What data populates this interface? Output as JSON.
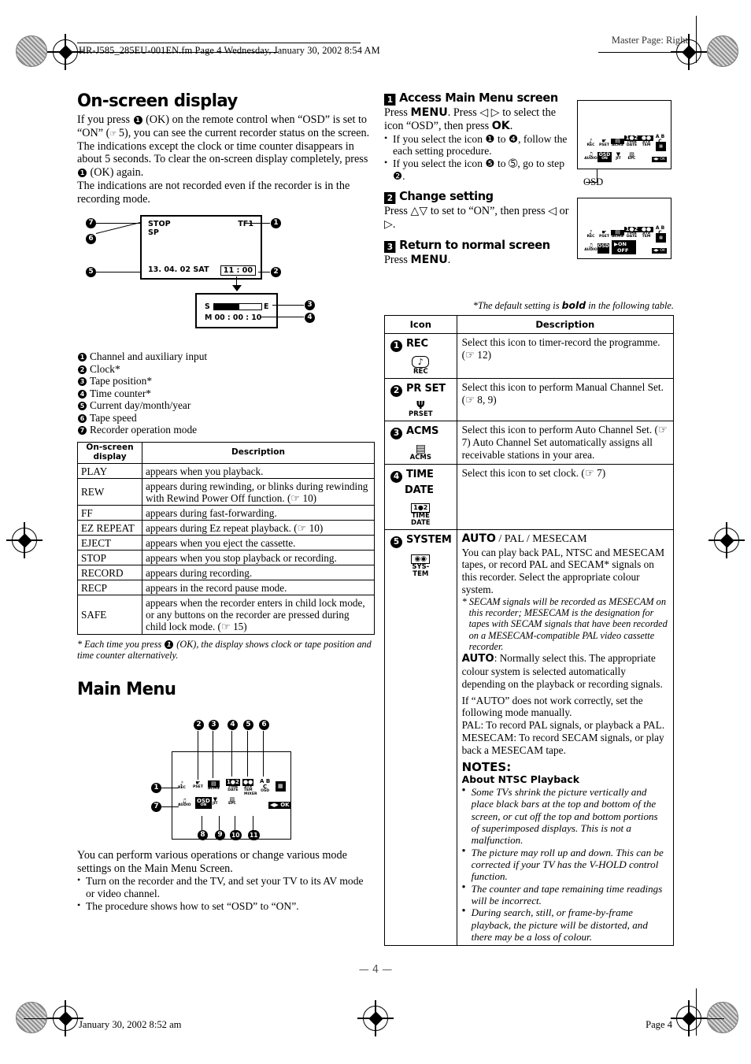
{
  "page": {
    "fm_header": "HR-J585_285EU-001EN.fm  Page 4  Wednesday, January 30, 2002  8:54 AM",
    "master_page": "Master Page: Right",
    "page_number": "— 4 —",
    "footer_left": "January 30, 2002 8:52 am",
    "footer_right": "Page 4"
  },
  "osd_section": {
    "title": "On-screen display",
    "intro_1": "If you press ",
    "intro_2": "(OK) on the remote control when “OSD” is set to “ON” (",
    "intro_2b": "5), you can see the current recorder status on the screen. The indications except the clock or time counter disappears in about 5 seconds. To clear the on-screen display completely, press ",
    "intro_3": "(OK) again.",
    "intro_4": "The indications are not recorded even if the recorder is in the recording mode.",
    "figure": {
      "mode": "STOP",
      "speed": "SP",
      "channel": "TF1",
      "date": "13. 04. 02 SAT",
      "clock": "11 : 00",
      "tape_start": "S",
      "tape_end": "E",
      "counter": "M 00 : 00 : 10"
    },
    "legend": [
      "Channel and auxiliary input",
      "Clock*",
      "Tape position*",
      "Time counter*",
      "Current day/month/year",
      "Tape speed",
      "Recorder operation mode"
    ],
    "table": {
      "head_display": "On-screen display",
      "head_description": "Description",
      "rows": [
        {
          "display": "PLAY",
          "description": "appears when you playback."
        },
        {
          "display": "REW",
          "description": "appears during rewinding, or blinks during rewinding with Rewind Power Off function. (☞ 10)"
        },
        {
          "display": "FF",
          "description": "appears during fast-forwarding."
        },
        {
          "display": "EZ REPEAT",
          "description": "appears during Ez repeat playback. (☞ 10)"
        },
        {
          "display": "EJECT",
          "description": "appears when you eject the cassette."
        },
        {
          "display": "STOP",
          "description": "appears when you stop playback or recording."
        },
        {
          "display": "RECORD",
          "description": "appears during recording."
        },
        {
          "display": "RECP",
          "description": "appears in the record pause mode."
        },
        {
          "display": "SAFE",
          "description": "appears when the recorder enters in child lock mode, or any buttons on the recorder are pressed during child lock mode. (☞ 15)"
        }
      ]
    },
    "footnote_pre": "* Each time you press ",
    "footnote_post": "(OK), the display shows clock or tape position and time counter alternatively."
  },
  "main_menu": {
    "title": "Main Menu",
    "intro": "You can perform various operations or change various mode settings on the Main Menu Screen.",
    "bullets": [
      "Turn on the recorder and the TV, and set your TV to its AV mode or video channel.",
      "The procedure shows how to set “OSD” to “ON”."
    ],
    "figure_icons": [
      {
        "n": "1",
        "label": "REC",
        "glyph": "♪"
      },
      {
        "n": "2",
        "label": "PR SET",
        "glyph": "Ɔ"
      },
      {
        "n": "3",
        "label": "ACMS",
        "glyph": "▣"
      },
      {
        "n": "4",
        "label": "TIME DATE",
        "glyph": "①"
      },
      {
        "n": "5",
        "label": "SYSTEM",
        "glyph": "▭"
      },
      {
        "n": "6",
        "label": "OSD",
        "glyph": "A B C"
      },
      {
        "n": "7",
        "label": "AUDIO",
        "glyph": "♫"
      },
      {
        "n": "8",
        "label": "OSD ON",
        "glyph": "OSD"
      },
      {
        "n": "9",
        "label": "JIT",
        "glyph": "▽"
      },
      {
        "n": "10",
        "label": "EPC",
        "glyph": "■"
      },
      {
        "n": "11",
        "label": "MIXER",
        "glyph": ""
      }
    ]
  },
  "steps": [
    {
      "num": "1",
      "title": "Access Main Menu screen",
      "body_1": "Press ",
      "body_bold_1": "MENU",
      "body_2": ". Press ◁ ▷ to select the icon “OSD”, then press ",
      "body_bold_2": "OK",
      "body_3": ".",
      "bullets": [
        "If you select the icon ❶ to ❹, follow the each setting procedure.",
        "If you select the icon ❺ to ➄, go to step ❷."
      ]
    },
    {
      "num": "2",
      "title": "Change setting",
      "body": "Press △▽ to set to “ON”, then press ◁ or ▷."
    },
    {
      "num": "3",
      "title": "Return to normal screen",
      "body_1": "Press ",
      "body_bold_1": "MENU",
      "body_3": "."
    }
  ],
  "screenshots": {
    "osd_caption": "OSD",
    "menu2_on": "ON",
    "menu2_off": "OFF"
  },
  "default_note_pre": "*The default setting is ",
  "default_note_bold": "bold",
  "default_note_post": " in the following table.",
  "icon_table": {
    "head_icon": "Icon",
    "head_description": "Description",
    "rows": [
      {
        "num": "1",
        "name": "REC",
        "art_glyph": "♪",
        "art_label": "REC",
        "description": "Select this icon to timer-record the programme. (☞ 12)"
      },
      {
        "num": "2",
        "name": "PR SET",
        "art_glyph": "⑂",
        "art_label": "P R SET",
        "description": "Select this icon to perform Manual Channel Set. (☞ 8, 9)"
      },
      {
        "num": "3",
        "name": "ACMS",
        "art_glyph": "▤",
        "art_label": "ACMS",
        "description": "Select this icon to perform Auto Channel Set. (☞ 7) Auto Channel Set automatically assigns all receivable stations in your area."
      },
      {
        "num": "4",
        "name": "TIME DATE",
        "art_glyph": "1 2",
        "art_label": "TIME DATE",
        "description": "Select this icon to set clock. (☞ 7)"
      },
      {
        "num": "5",
        "name": "SYSTEM",
        "art_glyph": "●●",
        "art_label": "SYS- TEM",
        "options_bold": "AUTO",
        "options_rest": " / PAL / MESECAM",
        "para_1": "You can play back PAL, NTSC and MESECAM tapes, or record PAL and SECAM* signals on this recorder. Select the appropriate colour system.",
        "para_footnote": "* SECAM signals will be recorded as MESECAM on this recorder; MESECAM is the designation for tapes with SECAM signals that have been recorded on a MESECAM-compatible PAL video cassette recorder.",
        "auto_label": "AUTO",
        "auto_text": ": Normally select this. The appropriate colour system is selected automatically depending on the playback or recording signals.",
        "para_2": "If “AUTO” does not work correctly, set the following mode manually.",
        "pal_text": "PAL: To record PAL signals, or playback a PAL.",
        "mesecam_text": "MESECAM: To record SECAM signals, or play back a MESECAM tape.",
        "notes_title": "NOTES:",
        "notes_subtitle": "About NTSC Playback",
        "notes": [
          "Some TVs shrink the picture vertically and place black bars at the top and bottom of the screen, or cut off the top and bottom portions of superimposed displays. This is not a malfunction.",
          "The picture may roll up and down. This can be corrected if your TV has the V-HOLD control function.",
          "The counter and tape remaining time readings will be incorrect.",
          "During search, still, or frame-by-frame playback, the picture will be distorted, and there may be a loss of colour."
        ]
      }
    ]
  }
}
